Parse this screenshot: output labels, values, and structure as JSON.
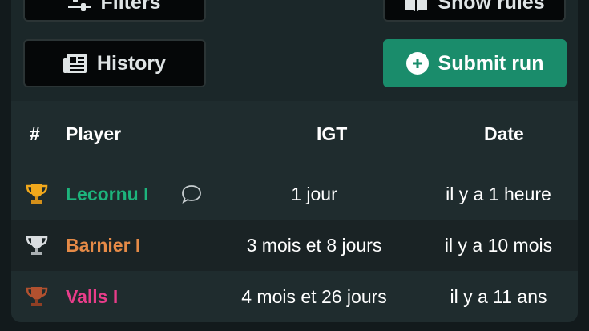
{
  "top_buttons": {
    "filters_label": "Filters",
    "rules_label": "Show rules"
  },
  "history_button": {
    "label": "History"
  },
  "submit_button": {
    "label": "Submit run"
  },
  "table": {
    "headers": {
      "rank": "#",
      "player": "Player",
      "igt": "IGT",
      "date": "Date"
    },
    "rows": [
      {
        "trophy": "gold",
        "player": "Lecornu I",
        "player_color": "#1db47c",
        "has_comment": true,
        "igt": "1 jour",
        "date": "il y a 1 heure"
      },
      {
        "trophy": "silver",
        "player": "Barnier I",
        "player_color": "#e58a47",
        "has_comment": false,
        "igt": "3 mois et 8 jours",
        "date": "il y a 10 mois"
      },
      {
        "trophy": "bronze",
        "player": "Valls I",
        "player_color": "#e83d8a",
        "has_comment": false,
        "igt": "4 mois et 26 jours",
        "date": "il y a 11 ans"
      }
    ]
  },
  "colors": {
    "accent_green": "#1a8c6b",
    "gold": "#f0a81c",
    "silver": "#d9dde0",
    "bronze": "#b1512f"
  }
}
